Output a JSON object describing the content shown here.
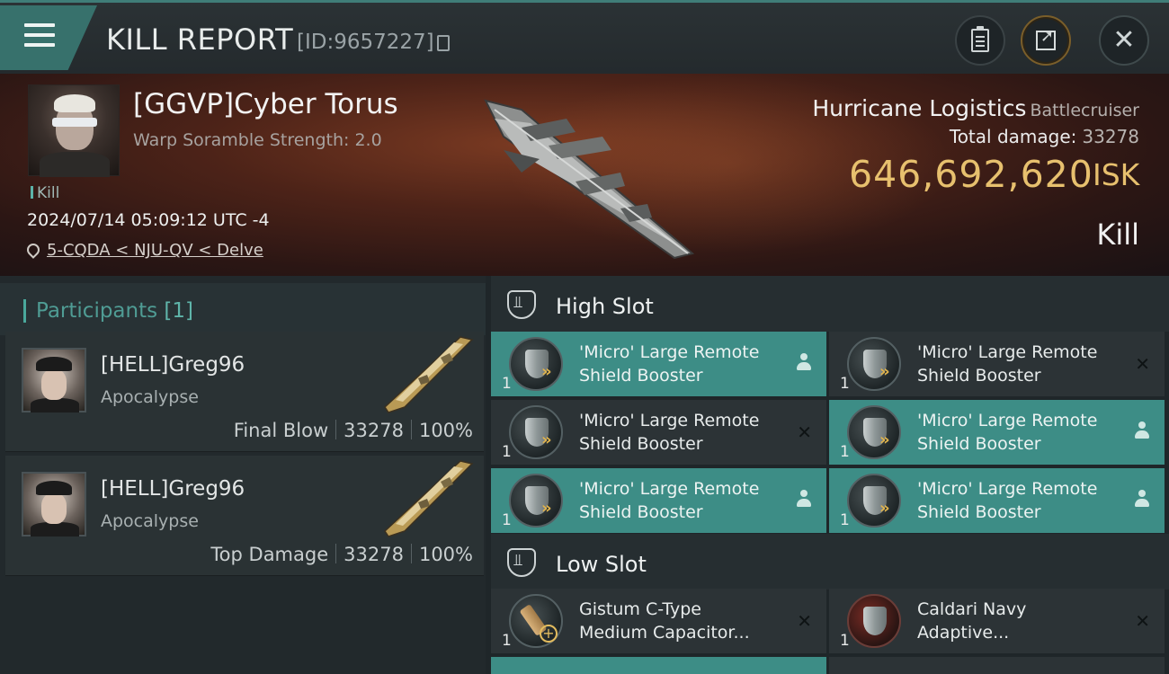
{
  "header": {
    "title": "KILL REPORT",
    "report_id": "[ID:9657227]"
  },
  "victim": {
    "name": "[GGVP]Cyber Torus",
    "scramble": "Warp Soramble Strength: 2.0",
    "tag": "Kill",
    "datetime": "2024/07/14 05:09:12 UTC -4",
    "location": "5-CQDA < NJU-QV < Delve"
  },
  "ship": {
    "name": "Hurricane Logistics",
    "class": "Battlecruiser",
    "total_damage_label": "Total damage:",
    "total_damage_value": "33278",
    "isk_value": "646,692,620",
    "isk_unit": "ISK",
    "result": "Kill"
  },
  "participants": {
    "title": "Participants",
    "count": "[1]",
    "cards": [
      {
        "name": "[HELL]Greg96",
        "ship": "Apocalypse",
        "role": "Final Blow",
        "damage": "33278",
        "percent": "100%"
      },
      {
        "name": "[HELL]Greg96",
        "ship": "Apocalypse",
        "role": "Top Damage",
        "damage": "33278",
        "percent": "100%"
      }
    ]
  },
  "high_slot": {
    "title": "High Slot",
    "modules": [
      {
        "name1": "'Micro' Large Remote",
        "name2": "Shield Booster",
        "qty": "1",
        "state": "dropped"
      },
      {
        "name1": "'Micro' Large Remote",
        "name2": "Shield Booster",
        "qty": "1",
        "state": "destroyed"
      },
      {
        "name1": "'Micro' Large Remote",
        "name2": "Shield Booster",
        "qty": "1",
        "state": "destroyed"
      },
      {
        "name1": "'Micro' Large Remote",
        "name2": "Shield Booster",
        "qty": "1",
        "state": "dropped"
      },
      {
        "name1": "'Micro' Large Remote",
        "name2": "Shield Booster",
        "qty": "1",
        "state": "dropped"
      },
      {
        "name1": "'Micro' Large Remote",
        "name2": "Shield Booster",
        "qty": "1",
        "state": "dropped"
      }
    ]
  },
  "low_slot": {
    "title": "Low Slot",
    "modules": [
      {
        "name1": "Gistum C-Type",
        "name2": "Medium Capacitor...",
        "qty": "1",
        "state": "destroyed"
      },
      {
        "name1": "Caldari Navy",
        "name2": "Adaptive...",
        "qty": "1",
        "state": "destroyed"
      }
    ]
  },
  "icons": {
    "menu": "menu-icon",
    "copy": "copy-icon",
    "clipboard": "clipboard-icon",
    "share": "share-icon",
    "close": "close-icon",
    "location": "location-pin-icon",
    "slot": "slot-icon",
    "dropped": "person-icon",
    "destroyed": "x-icon"
  },
  "colors": {
    "accent": "#3d8d86",
    "isk": "#e7c06e",
    "banner": "#4d2318"
  }
}
